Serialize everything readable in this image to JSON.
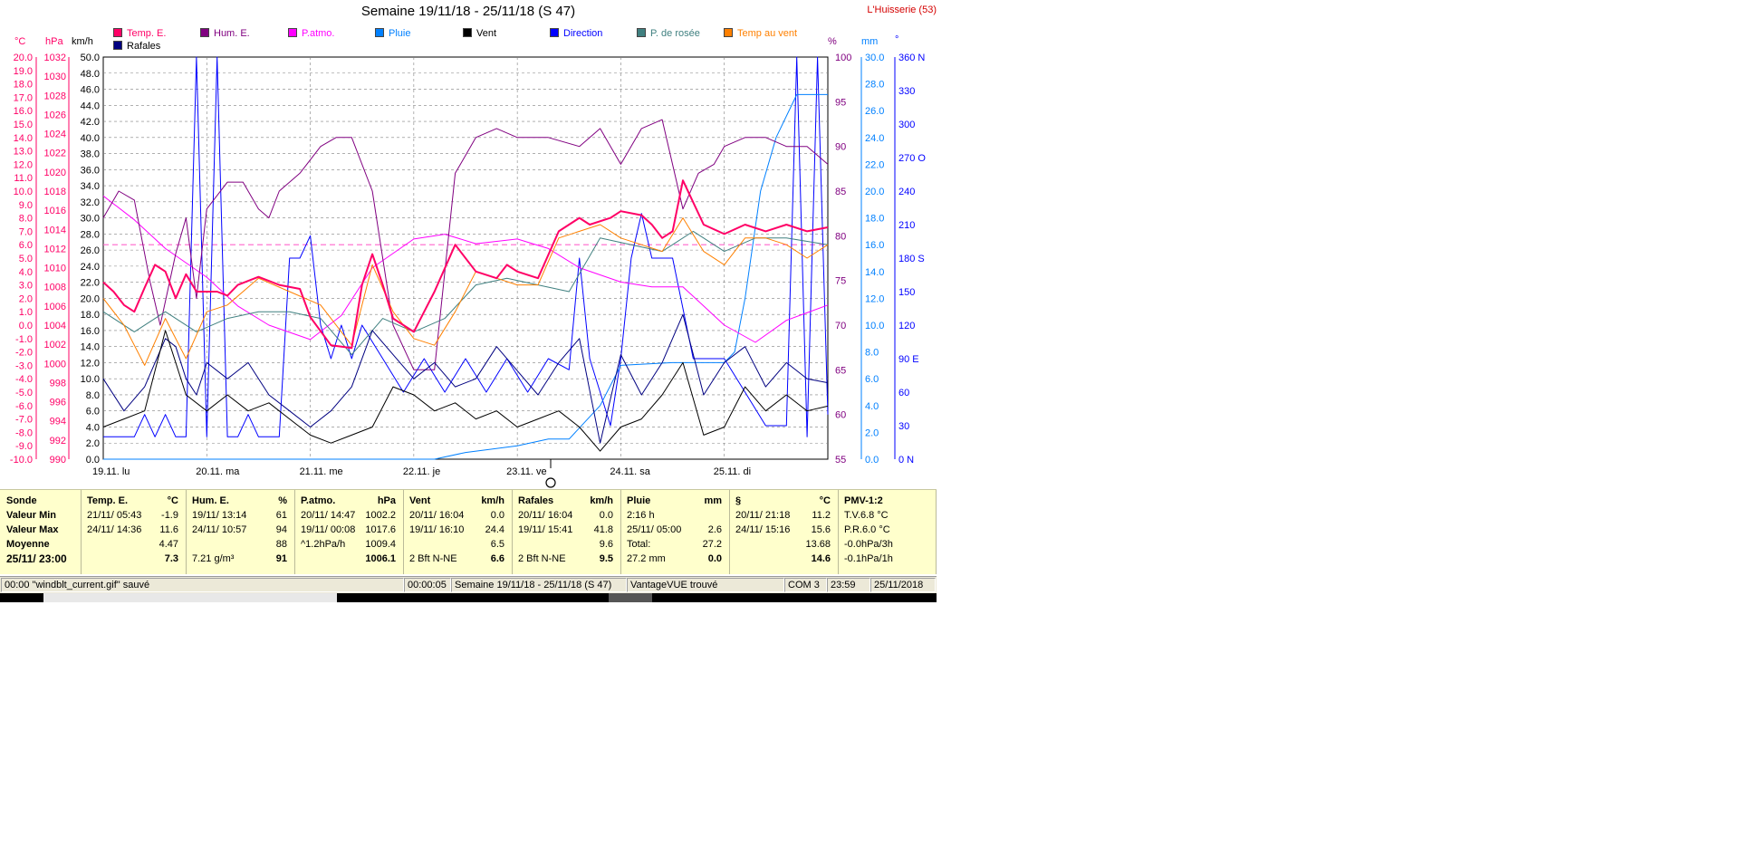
{
  "title": "Semaine 19/11/18 - 25/11/18 (S 47)",
  "station": "L'Huisserie (53)",
  "axis_units": {
    "temp": "°C",
    "press": "hPa",
    "wind": "km/h",
    "hum": "%",
    "rain": "mm",
    "dir": "°"
  },
  "legend": [
    {
      "label": "Temp. E.",
      "color": "#ff0066"
    },
    {
      "label": "Hum. E.",
      "color": "#800080"
    },
    {
      "label": "P.atmo.",
      "color": "#ff00ff"
    },
    {
      "label": "Pluie",
      "color": "#0080ff"
    },
    {
      "label": "Vent",
      "color": "#000000"
    },
    {
      "label": "Direction",
      "color": "#0000ff"
    },
    {
      "label": "P. de rosée",
      "color": "#408080"
    },
    {
      "label": "Temp au vent",
      "color": "#ff8000"
    },
    {
      "label": "Rafales",
      "color": "#000080"
    }
  ],
  "chart_data": {
    "type": "line",
    "x_labels": [
      "19.11. lu",
      "20.11. ma",
      "21.11. me",
      "22.11. je",
      "23.11. ve",
      "24.11. sa",
      "25.11. di"
    ],
    "x_range": [
      0,
      7
    ],
    "axes": {
      "temp": {
        "min": -10,
        "max": 20,
        "step": 1,
        "color": "#ff0066"
      },
      "press": {
        "min": 990,
        "max": 1032,
        "step": 2,
        "color": "#ff0066"
      },
      "wind": {
        "min": 0,
        "max": 50,
        "step": 2,
        "color": "#000000"
      },
      "hum": {
        "min": 55,
        "max": 100,
        "step": 5,
        "color": "#800080"
      },
      "rain": {
        "min": 0,
        "max": 30,
        "step": 2,
        "color": "#0080ff"
      },
      "dir": {
        "min": 0,
        "max": 360,
        "step": 30,
        "color": "#0000ff",
        "labels": [
          "0 N",
          "30",
          "60",
          "90 E",
          "120",
          "150",
          "180 S",
          "210",
          "240",
          "270 O",
          "300",
          "330",
          "360 N"
        ]
      }
    },
    "series": [
      {
        "name": "Temp. E.",
        "axis": "temp",
        "color": "#ff0066",
        "width": 2,
        "x": [
          0,
          0.1,
          0.2,
          0.3,
          0.4,
          0.5,
          0.6,
          0.7,
          0.8,
          0.9,
          1.0,
          1.1,
          1.2,
          1.3,
          1.5,
          1.7,
          1.9,
          2.0,
          2.2,
          2.4,
          2.5,
          2.6,
          2.7,
          2.8,
          3.0,
          3.1,
          3.2,
          3.4,
          3.6,
          3.8,
          3.9,
          4.0,
          4.2,
          4.4,
          4.6,
          4.7,
          4.9,
          5.0,
          5.2,
          5.3,
          5.4,
          5.5,
          5.6,
          5.8,
          6.0,
          6.2,
          6.4,
          6.6,
          6.8,
          7.0
        ],
        "y": [
          3.2,
          2.5,
          1.5,
          1.0,
          2.8,
          4.5,
          4.0,
          2.0,
          3.8,
          2.5,
          2.5,
          2.5,
          2.2,
          3.0,
          3.6,
          3.0,
          2.7,
          0.6,
          -1.5,
          -1.7,
          3.0,
          5.3,
          3.0,
          0.5,
          -0.5,
          1.0,
          2.5,
          6.0,
          4.0,
          3.5,
          4.5,
          4.0,
          3.5,
          7.0,
          8.0,
          7.5,
          8.0,
          8.5,
          8.2,
          7.5,
          6.5,
          7.0,
          10.8,
          7.5,
          6.8,
          7.5,
          7.0,
          7.5,
          7.0,
          7.3
        ]
      },
      {
        "name": "Hum. E.",
        "axis": "hum",
        "color": "#800080",
        "width": 1,
        "x": [
          0,
          0.15,
          0.3,
          0.45,
          0.55,
          0.7,
          0.8,
          0.9,
          1.0,
          1.2,
          1.35,
          1.5,
          1.6,
          1.7,
          1.9,
          2.1,
          2.25,
          2.4,
          2.6,
          2.8,
          3.0,
          3.2,
          3.4,
          3.6,
          3.8,
          4.0,
          4.3,
          4.6,
          4.8,
          5.0,
          5.2,
          5.4,
          5.6,
          5.75,
          5.9,
          6.0,
          6.2,
          6.4,
          6.6,
          6.8,
          7.0
        ],
        "y": [
          82,
          85,
          84,
          75,
          70,
          78,
          82,
          73,
          83,
          86,
          86,
          83,
          82,
          85,
          87,
          90,
          91,
          91,
          85,
          70,
          65,
          65,
          87,
          91,
          92,
          91,
          91,
          90,
          92,
          88,
          92,
          93,
          83,
          87,
          88,
          90,
          91,
          91,
          90,
          90,
          88
        ]
      },
      {
        "name": "P.atmo.",
        "axis": "press",
        "color": "#ff00ff",
        "width": 1,
        "x": [
          0,
          0.3,
          0.6,
          1.0,
          1.3,
          1.6,
          2.0,
          2.3,
          2.6,
          3.0,
          3.3,
          3.6,
          4.0,
          4.3,
          4.6,
          5.0,
          5.3,
          5.6,
          6.0,
          6.3,
          6.6,
          7.0
        ],
        "y": [
          1017.5,
          1015,
          1012,
          1009,
          1006,
          1004,
          1002.5,
          1005,
          1010,
          1013,
          1013.5,
          1012.5,
          1013,
          1012,
          1010,
          1008.5,
          1008,
          1008,
          1004,
          1002.2,
          1004.5,
          1006.1
        ]
      },
      {
        "name": "P. de rosée",
        "axis": "temp",
        "color": "#408080",
        "width": 1,
        "x": [
          0,
          0.3,
          0.6,
          0.9,
          1.2,
          1.5,
          1.8,
          2.1,
          2.4,
          2.7,
          3.0,
          3.3,
          3.6,
          3.9,
          4.2,
          4.5,
          4.8,
          5.1,
          5.4,
          5.7,
          6.0,
          6.3,
          6.6,
          7.0
        ],
        "y": [
          1.0,
          -0.5,
          1.0,
          -0.5,
          0.5,
          1.0,
          1.0,
          0.5,
          -2.2,
          0.5,
          -0.5,
          0.5,
          3.0,
          3.5,
          3.0,
          2.5,
          6.5,
          6.0,
          5.5,
          7.0,
          5.5,
          6.5,
          6.5,
          6.0
        ]
      },
      {
        "name": "Temp au vent",
        "axis": "temp",
        "color": "#ff8000",
        "width": 1,
        "x": [
          0,
          0.2,
          0.4,
          0.6,
          0.8,
          1.0,
          1.2,
          1.5,
          1.8,
          2.1,
          2.4,
          2.6,
          2.8,
          3.0,
          3.2,
          3.4,
          3.6,
          3.8,
          4.0,
          4.2,
          4.4,
          4.6,
          4.8,
          5.0,
          5.2,
          5.4,
          5.6,
          5.8,
          6.0,
          6.2,
          6.4,
          6.6,
          6.8,
          7.0
        ],
        "y": [
          2.0,
          0,
          -3.0,
          0.5,
          -2.5,
          1.0,
          1.5,
          3.5,
          2.5,
          1.5,
          -1.5,
          4.5,
          1.0,
          -1.0,
          -1.5,
          1.0,
          4.0,
          3.5,
          3.0,
          3.0,
          6.5,
          7.0,
          7.5,
          6.5,
          6.0,
          5.5,
          8.0,
          5.5,
          4.5,
          6.5,
          6.5,
          6.0,
          5.0,
          6.0
        ]
      },
      {
        "name": "Vent",
        "axis": "wind",
        "color": "#000000",
        "width": 1,
        "x": [
          0,
          0.2,
          0.4,
          0.6,
          0.7,
          0.8,
          1.0,
          1.2,
          1.4,
          1.6,
          1.8,
          2.0,
          2.2,
          2.4,
          2.6,
          2.8,
          3.0,
          3.2,
          3.4,
          3.6,
          3.8,
          4.0,
          4.2,
          4.4,
          4.6,
          4.8,
          5.0,
          5.2,
          5.4,
          5.6,
          5.8,
          6.0,
          6.2,
          6.4,
          6.6,
          6.8,
          7.0
        ],
        "y": [
          4,
          5,
          6,
          16,
          12,
          8,
          6,
          8,
          6,
          7,
          5,
          3,
          2,
          3,
          4,
          9,
          8,
          6,
          7,
          5,
          6,
          4,
          5,
          6,
          4,
          1,
          4,
          5,
          8,
          12,
          3,
          4,
          9,
          6,
          8,
          6,
          6.6
        ]
      },
      {
        "name": "Rafales",
        "axis": "wind",
        "color": "#000080",
        "width": 1,
        "x": [
          0,
          0.2,
          0.4,
          0.6,
          0.7,
          0.8,
          0.9,
          1.0,
          1.2,
          1.4,
          1.6,
          1.8,
          2.0,
          2.2,
          2.4,
          2.6,
          2.8,
          3.0,
          3.2,
          3.4,
          3.6,
          3.8,
          4.0,
          4.2,
          4.4,
          4.6,
          4.8,
          5.0,
          5.2,
          5.4,
          5.6,
          5.8,
          6.0,
          6.2,
          6.4,
          6.6,
          6.8,
          7.0
        ],
        "y": [
          10,
          6,
          9,
          15,
          14,
          10,
          8,
          12,
          10,
          12,
          8,
          6,
          4,
          6,
          9,
          16,
          13,
          10,
          12,
          9,
          10,
          14,
          11,
          8,
          12,
          15,
          2,
          13,
          8,
          12,
          18,
          8,
          12,
          14,
          9,
          12,
          10,
          9.5
        ]
      },
      {
        "name": "Pluie",
        "axis": "rain",
        "color": "#0080ff",
        "width": 1,
        "x": [
          0,
          3.2,
          3.5,
          4.0,
          4.3,
          4.5,
          4.8,
          5.0,
          5.5,
          6.0,
          6.1,
          6.2,
          6.35,
          6.5,
          6.7,
          6.9,
          7.0
        ],
        "y": [
          0,
          0,
          0.5,
          1.0,
          1.5,
          1.5,
          4.0,
          7.0,
          7.2,
          7.2,
          8.0,
          12,
          20,
          24,
          27.2,
          27.2,
          27.2
        ]
      },
      {
        "name": "Direction",
        "axis": "dir",
        "color": "#0000ff",
        "width": 1,
        "x": [
          0,
          0.3,
          0.4,
          0.5,
          0.6,
          0.7,
          0.8,
          0.9,
          1.0,
          1.1,
          1.2,
          1.3,
          1.4,
          1.5,
          1.6,
          1.7,
          1.8,
          1.9,
          2.0,
          2.1,
          2.2,
          2.3,
          2.4,
          2.5,
          2.7,
          2.9,
          3.1,
          3.3,
          3.5,
          3.7,
          3.9,
          4.1,
          4.3,
          4.5,
          4.6,
          4.7,
          4.8,
          4.9,
          5.0,
          5.1,
          5.2,
          5.3,
          5.4,
          5.5,
          5.7,
          5.9,
          6.0,
          6.2,
          6.4,
          6.6,
          6.7,
          6.8,
          6.9,
          7.0
        ],
        "y": [
          20,
          20,
          40,
          20,
          40,
          20,
          20,
          360,
          20,
          360,
          20,
          20,
          40,
          20,
          20,
          20,
          180,
          180,
          200,
          120,
          90,
          120,
          90,
          120,
          90,
          60,
          90,
          60,
          90,
          60,
          90,
          60,
          90,
          80,
          180,
          90,
          60,
          30,
          90,
          180,
          220,
          180,
          180,
          180,
          90,
          90,
          90,
          60,
          30,
          30,
          360,
          20,
          360,
          40
        ]
      }
    ],
    "ref_lines": [
      {
        "axis": "temp",
        "y": 6.0,
        "color": "#ff66cc",
        "dash": true
      }
    ]
  },
  "table": {
    "c0": {
      "h": "Sonde",
      "r1": "Valeur Min",
      "r2": "Valeur Max",
      "r3": "Moyenne",
      "r4": "25/11/ 23:00"
    },
    "c1": {
      "h": "Temp. E.",
      "u": "°C",
      "r1a": "21/11/ 05:43",
      "r1b": "-1.9",
      "r2a": "24/11/ 14:36",
      "r2b": "11.6",
      "r3b": "4.47",
      "r4b": "7.3"
    },
    "c2": {
      "h": "Hum. E.",
      "u": "%",
      "r1a": "19/11/ 13:14",
      "r1b": "61",
      "r2a": "24/11/ 10:57",
      "r2b": "94",
      "r3b": "88",
      "r4a": "7.21 g/m³",
      "r4b": "91"
    },
    "c3": {
      "h": "P.atmo.",
      "u": "hPa",
      "r1a": "20/11/ 14:47",
      "r1b": "1002.2",
      "r2a": "19/11/ 00:08",
      "r2b": "1017.6",
      "r3a": "^1.2hPa/h",
      "r3b": "1009.4",
      "r4b": "1006.1"
    },
    "c4": {
      "h": "Vent",
      "u": "km/h",
      "r1a": "20/11/ 16:04",
      "r1b": "0.0",
      "r2a": "19/11/ 16:10",
      "r2b": "24.4",
      "r3b": "6.5",
      "r4a": "2 Bft N-NE",
      "r4b": "6.6"
    },
    "c5": {
      "h": "Rafales",
      "u": "km/h",
      "r1a": "20/11/ 16:04",
      "r1b": "0.0",
      "r2a": "19/11/ 15:41",
      "r2b": "41.8",
      "r3b": "9.6",
      "r4a": "2 Bft N-NE",
      "r4b": "9.5"
    },
    "c6": {
      "h": "Pluie",
      "u": "mm",
      "r1a": "2:16 h",
      "r2a": "25/11/ 05:00",
      "r2b": "2.6",
      "r3a": "Total:",
      "r3b": "27.2",
      "r4a": "27.2 mm",
      "r4b": "0.0"
    },
    "c7": {
      "h": "§",
      "u": "°C",
      "r1a": "20/11/ 21:18",
      "r1b": "11.2",
      "r2a": "24/11/ 15:16",
      "r2b": "15.6",
      "r3b": "13.68",
      "r4b": "14.6"
    },
    "c8": {
      "h": "PMV-1:2",
      "r1a": "T.V.6.8 °C",
      "r2a": "P.R.6.0 °C",
      "r3a": "-0.0hPa/3h",
      "r4a": "-0.1hPa/1h"
    }
  },
  "status": {
    "msg": "00:00  \"windblt_current.gif\"  sauvé",
    "elapsed": "00:00:05",
    "period": "Semaine 19/11/18 - 25/11/18 (S 47)",
    "device": "VantageVUE trouvé",
    "port": "COM 3",
    "time": "23:59",
    "date": "25/11/2018"
  }
}
